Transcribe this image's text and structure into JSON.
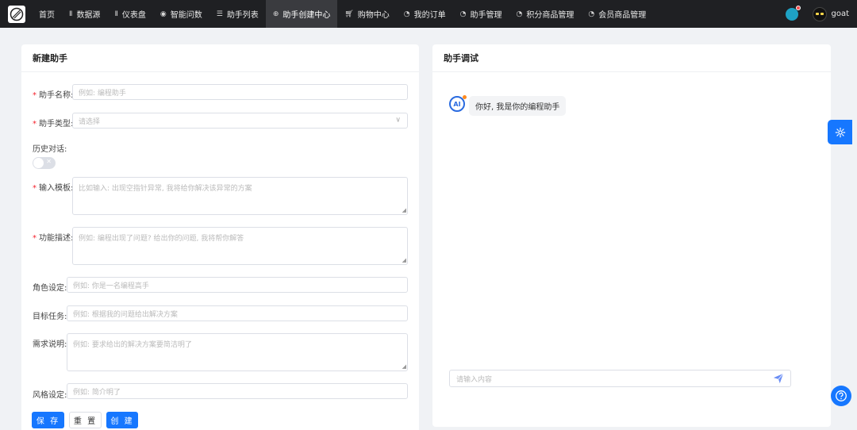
{
  "nav": {
    "items": [
      {
        "label": "首页",
        "icon": "none"
      },
      {
        "label": "数据源",
        "icon": "bar-chart-icon"
      },
      {
        "label": "仪表盘",
        "icon": "bar-chart-icon"
      },
      {
        "label": "智能问数",
        "icon": "chat-icon"
      },
      {
        "label": "助手列表",
        "icon": "list-icon"
      },
      {
        "label": "助手创建中心",
        "icon": "plus-circle-icon",
        "active": true
      },
      {
        "label": "购物中心",
        "icon": "cart-icon"
      },
      {
        "label": "我的订单",
        "icon": "pie-icon"
      },
      {
        "label": "助手管理",
        "icon": "pie-icon"
      },
      {
        "label": "积分商品管理",
        "icon": "pie-icon"
      },
      {
        "label": "会员商品管理",
        "icon": "pie-icon"
      }
    ],
    "username": "goat"
  },
  "form": {
    "title": "新建助手",
    "name_label": "助手名称:",
    "name_placeholder": "例如: 编程助手",
    "type_label": "助手类型:",
    "type_placeholder": "请选择",
    "history_label": "历史对话:",
    "history_enabled": false,
    "template_label": "输入模板:",
    "template_placeholder": "比如输入: 出现空指针异常, 我将给你解决该异常的方案",
    "desc_label": "功能描述:",
    "desc_placeholder": "例如: 编程出现了问题? 给出你的问题, 我将帮你解答",
    "role_label": "角色设定:",
    "role_placeholder": "例如: 你是一名编程高手",
    "goal_label": "目标任务:",
    "goal_placeholder": "例如: 根据我的问题给出解决方案",
    "req_label": "需求说明:",
    "req_placeholder": "例如: 要求给出的解决方案要简洁明了",
    "style_label": "风格设定:",
    "style_placeholder": "例如: 简介明了",
    "save_label": "保 存",
    "reset_label": "重 置",
    "create_label": "创 建"
  },
  "debug": {
    "title": "助手调试",
    "ai_badge": "AI",
    "greeting": "你好, 我是你的编程助手",
    "input_placeholder": "请输入内容"
  },
  "colors": {
    "primary": "#1677ff",
    "nav_bg": "#1f2023",
    "required": "#f5222d"
  }
}
